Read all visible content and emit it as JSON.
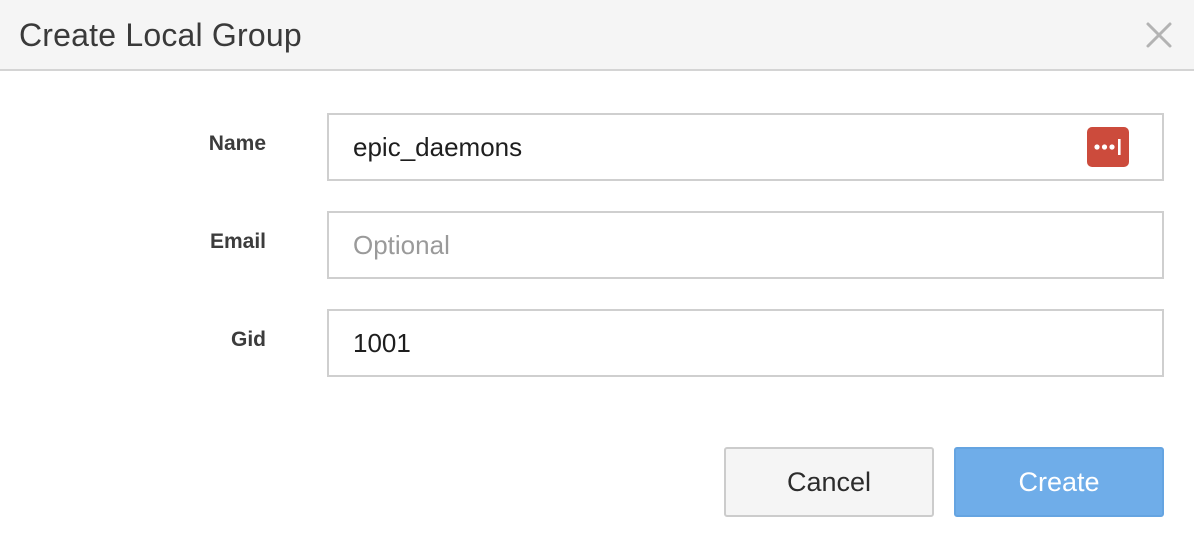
{
  "dialog": {
    "title": "Create Local Group",
    "close_icon": "close-icon"
  },
  "form": {
    "name": {
      "label": "Name",
      "value": "epic_daemons",
      "placeholder": "",
      "badge_icon": "password-manager-icon",
      "badge_color": "#cc4b3c"
    },
    "email": {
      "label": "Email",
      "value": "",
      "placeholder": "Optional"
    },
    "gid": {
      "label": "Gid",
      "value": "1001",
      "placeholder": ""
    }
  },
  "actions": {
    "cancel_label": "Cancel",
    "create_label": "Create",
    "create_color": "#6fade9"
  }
}
